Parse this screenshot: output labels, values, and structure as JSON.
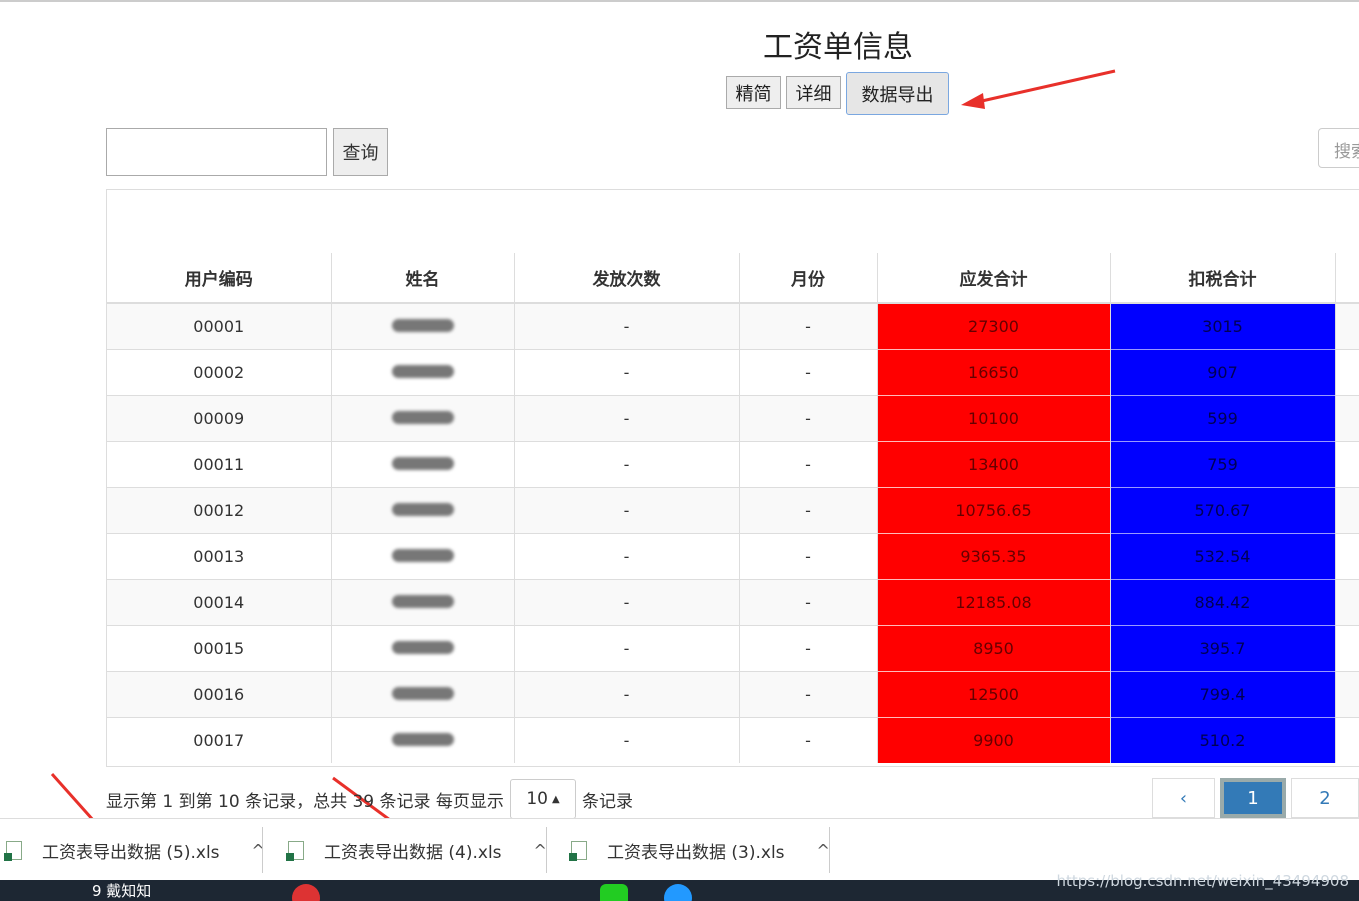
{
  "page": {
    "title": "工资单信息"
  },
  "buttons": {
    "simple": "精简",
    "detail": "详细",
    "export": "数据导出",
    "query": "查询"
  },
  "right_search": {
    "placeholder": "搜索"
  },
  "table": {
    "headers": [
      "用户编码",
      "姓名",
      "发放次数",
      "月份",
      "应发合计",
      "扣税合计"
    ],
    "rows": [
      {
        "code": "00001",
        "count": "-",
        "month": "-",
        "gross": "27300",
        "tax": "3015"
      },
      {
        "code": "00002",
        "count": "-",
        "month": "-",
        "gross": "16650",
        "tax": "907"
      },
      {
        "code": "00009",
        "count": "-",
        "month": "-",
        "gross": "10100",
        "tax": "599"
      },
      {
        "code": "00011",
        "count": "-",
        "month": "-",
        "gross": "13400",
        "tax": "759"
      },
      {
        "code": "00012",
        "count": "-",
        "month": "-",
        "gross": "10756.65",
        "tax": "570.67"
      },
      {
        "code": "00013",
        "count": "-",
        "month": "-",
        "gross": "9365.35",
        "tax": "532.54"
      },
      {
        "code": "00014",
        "count": "-",
        "month": "-",
        "gross": "12185.08",
        "tax": "884.42"
      },
      {
        "code": "00015",
        "count": "-",
        "month": "-",
        "gross": "8950",
        "tax": "395.7"
      },
      {
        "code": "00016",
        "count": "-",
        "month": "-",
        "gross": "12500",
        "tax": "799.4"
      },
      {
        "code": "00017",
        "count": "-",
        "month": "-",
        "gross": "9900",
        "tax": "510.2"
      }
    ]
  },
  "pagination": {
    "summary": "显示第 1 到第 10 条记录，总共 39 条记录 每页显示",
    "page_size": "10",
    "suffix": "条记录",
    "prev": "‹",
    "pages": [
      "1",
      "2"
    ]
  },
  "downloads": [
    {
      "name": "工资表导出数据 (5).xls"
    },
    {
      "name": "工资表导出数据 (4).xls"
    },
    {
      "name": "工资表导出数据 (3).xls"
    }
  ],
  "taskbar": {
    "text": "9 戴知知"
  },
  "watermark": "https://blog.csdn.net/weixin_43494908",
  "colors": {
    "gross_bg": "#ff0000",
    "tax_bg": "#0000ff",
    "arrow": "#e8302a",
    "active_page": "#337ab7"
  }
}
